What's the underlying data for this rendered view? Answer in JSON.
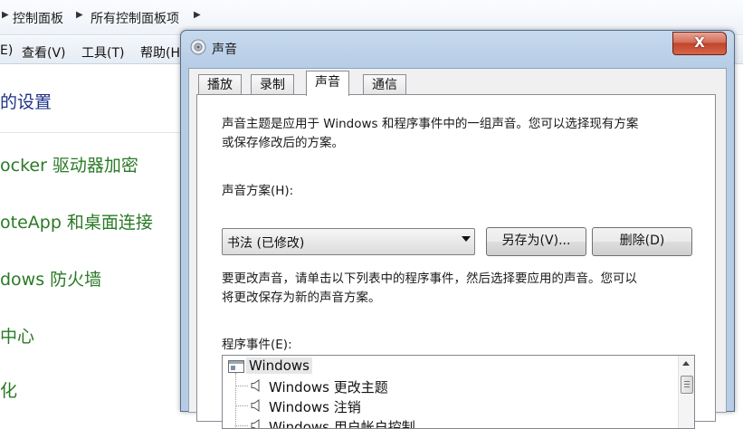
{
  "background_window": {
    "breadcrumbs": [
      "控制面板",
      "所有控制面板项"
    ],
    "menu": [
      "E)",
      "查看(V)",
      "工具(T)",
      "帮助(H)"
    ],
    "heading": "的设置",
    "links": [
      "ocker 驱动器加密",
      "oteApp 和桌面连接",
      "dows 防火墙",
      "中心",
      "化"
    ]
  },
  "dialog": {
    "title": "声音",
    "close_label": "X",
    "tabs": [
      "播放",
      "录制",
      "声音",
      "通信"
    ],
    "active_tab": "声音",
    "description_lines": [
      "声音主题是应用于 Windows 和程序事件中的一组声音。您可以选择现有方案",
      "或保存修改后的方案。"
    ],
    "scheme_label": "声音方案(H):",
    "scheme_value": "书法 (已修改)",
    "save_as_label": "另存为(V)...",
    "delete_label": "删除(D)",
    "instruction_lines": [
      "要更改声音，请单击以下列表中的程序事件，然后选择要应用的声音。您可以",
      "将更改保存为新的声音方案。"
    ],
    "events_label": "程序事件(E):",
    "events": {
      "root": "Windows",
      "items": [
        "Windows 更改主题",
        "Windows 注销",
        "Windows 用户帐户控制"
      ]
    }
  }
}
